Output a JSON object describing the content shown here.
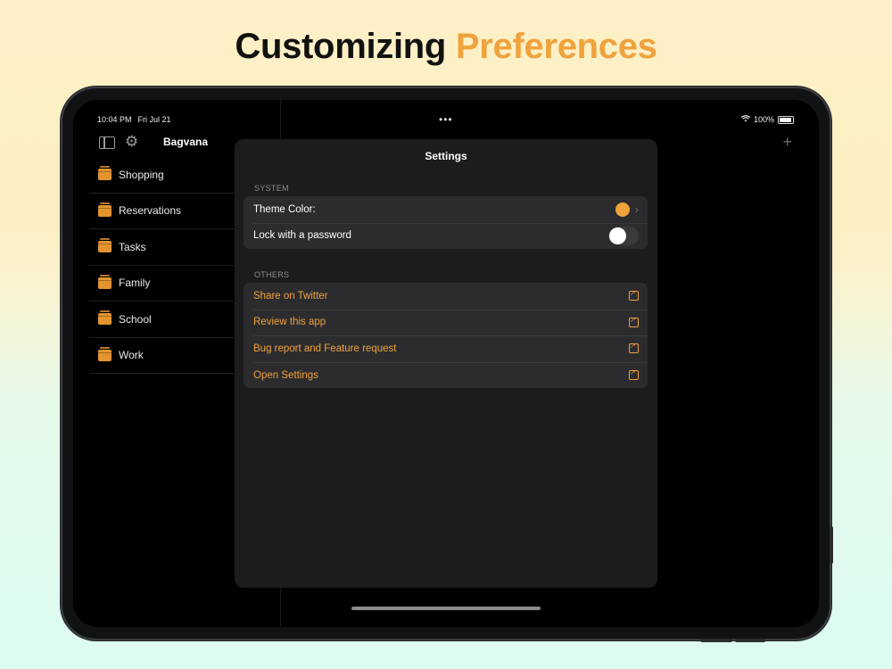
{
  "headline": {
    "part1": "Customizing ",
    "part2": "Preferences"
  },
  "status_bar": {
    "time": "10:04 PM",
    "date": "Fri Jul 21",
    "dots": "•••",
    "battery": "100%"
  },
  "sidebar": {
    "title": "Bagvana",
    "folders": [
      {
        "label": "Shopping",
        "has_dot": true
      },
      {
        "label": "Reservations",
        "has_dot": true
      },
      {
        "label": "Tasks",
        "has_dot": false
      },
      {
        "label": "Family",
        "has_dot": false
      },
      {
        "label": "School",
        "has_dot": true
      },
      {
        "label": "Work",
        "has_dot": false
      }
    ]
  },
  "detail": {
    "add_label": "+"
  },
  "settings": {
    "title": "Settings",
    "system_header": "SYSTEM",
    "theme_color_label": "Theme Color:",
    "theme_color": "#f0a23c",
    "lock_label": "Lock with a password",
    "lock_enabled": false,
    "others_header": "OTHERS",
    "others": [
      "Share on Twitter",
      "Review this app",
      "Bug report and Feature request",
      "Open Settings"
    ]
  },
  "colors": {
    "accent": "#f0a23c",
    "background": "#000000",
    "panel": "#1c1c1e",
    "row": "#2c2c2e"
  },
  "icons": [
    "sidebar-toggle-icon",
    "gear-icon",
    "folder-icon",
    "plus-icon",
    "chevron-right-icon",
    "external-link-icon",
    "wifi-icon",
    "battery-icon"
  ]
}
